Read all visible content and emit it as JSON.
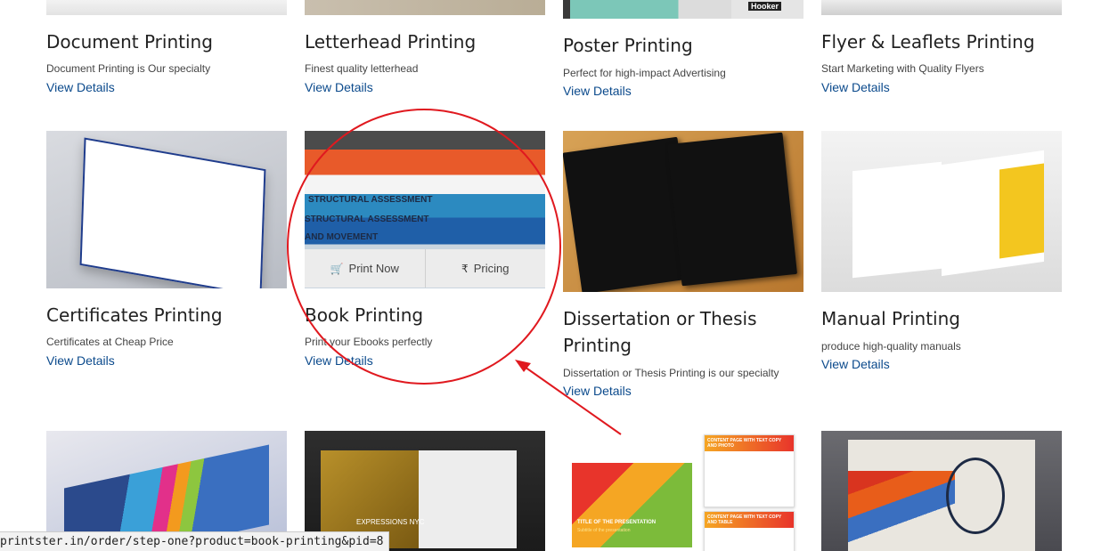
{
  "products": {
    "row1": [
      {
        "title": "Document Printing",
        "desc": "Document Printing is Our specialty",
        "link": "View Details"
      },
      {
        "title": "Letterhead Printing",
        "desc": "Finest quality letterhead",
        "link": "View Details"
      },
      {
        "title": "Poster Printing",
        "desc": "Perfect for high-impact Advertising",
        "link": "View Details"
      },
      {
        "title": "Flyer & Leaflets Printing",
        "desc": "Start Marketing with Quality Flyers",
        "link": "View Details"
      }
    ],
    "row2": [
      {
        "title": "Certificates Printing",
        "desc": "Certificates at Cheap Price",
        "link": "View Details"
      },
      {
        "title": "Book Printing",
        "desc": "Print your Ebooks perfectly",
        "link": "View Details"
      },
      {
        "title": "Dissertation or Thesis Printing",
        "desc": "Dissertation or Thesis Printing is our specialty",
        "link": "View Details"
      },
      {
        "title": "Manual Printing",
        "desc": "produce high-quality manuals",
        "link": "View Details"
      }
    ]
  },
  "hover_overlay": {
    "print_now": "Print Now",
    "pricing": "Pricing",
    "print_icon": "cart-icon",
    "pricing_icon": "rupee-icon"
  },
  "image_text": {
    "book_spines": [
      "STRUCTURAL ASSESSMENT",
      "STRUCTURAL ASSESSMENT",
      "AND MOVEMENT"
    ],
    "poster_badge": "Hooker",
    "catalog_text": "EXPRESSIONS NYC",
    "presentation_title": "TITLE OF THE PRESENTATION",
    "presentation_subtitle": "Subtitle of the presentation",
    "content_page_1": "CONTENT PAGE WITH TEXT COPY AND PHOTO",
    "content_page_2": "CONTENT PAGE WITH TEXT COPY AND TABLE"
  },
  "status_url": "printster.in/order/step-one?product=book-printing&pid=8",
  "colors": {
    "link": "#0b4a8c",
    "annotation": "#e0191f"
  }
}
